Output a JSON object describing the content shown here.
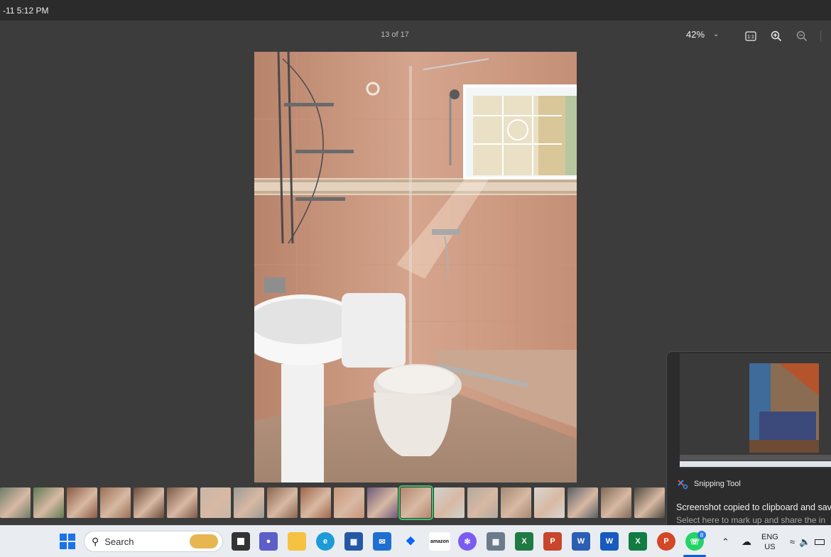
{
  "titlebar": {
    "text": "-11 5:12 PM"
  },
  "viewer": {
    "counter": "13 of 17",
    "zoom_level": "42%",
    "actual_size_label": "1:1"
  },
  "filmstrip": {
    "count": 20,
    "selected_index": 12
  },
  "toast": {
    "app_name": "Snipping Tool",
    "message": "Screenshot copied to clipboard and sav",
    "subtext": "Select here to mark up and share the in"
  },
  "taskbar": {
    "search_label": "Search",
    "language_line1": "ENG",
    "language_line2": "US",
    "whatsapp_badge": "8",
    "accent_color": "#0a5fd6"
  }
}
